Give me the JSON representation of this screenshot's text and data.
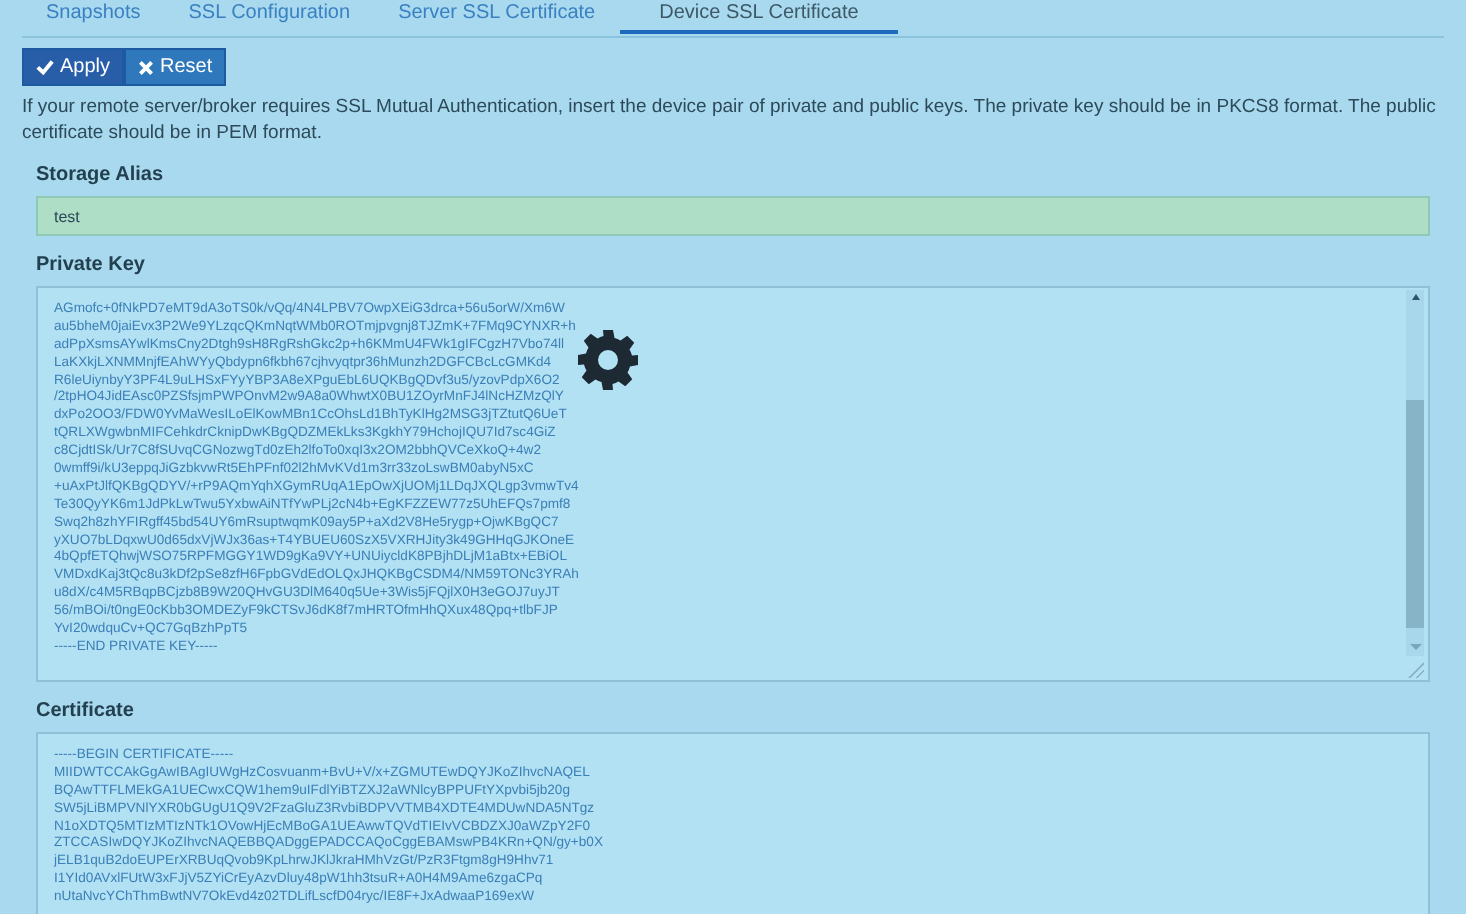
{
  "tabs": [
    {
      "label": "Snapshots",
      "selected": false
    },
    {
      "label": "SSL Configuration",
      "selected": false
    },
    {
      "label": "Server SSL Certificate",
      "selected": false
    },
    {
      "label": "Device SSL Certificate",
      "selected": true
    }
  ],
  "buttons": [
    {
      "kind": "apply",
      "label": "Apply"
    },
    {
      "kind": "reset",
      "label": "Reset"
    }
  ],
  "description": "If your remote server/broker requires SSL Mutual Authentication, insert the device pair of private and public keys. The private key should be in PKCS8 format. The public certificate should be in PEM format.",
  "fields": [
    {
      "kind": "input",
      "label": "Storage Alias",
      "value": "test",
      "valid": true
    },
    {
      "kind": "textarea",
      "label": "Private Key",
      "busy": true,
      "lines": [
        "AGmofc+0fNkPD7eMT9dA3oTS0k/vQq/4N4LPBV7OwpXEiG3drca+56u5orW/Xm6W",
        "au5bheM0jaiEvx3P2We9YLzqcQKmNqtWMb0ROTmjpvgnj8TJZmK+7FMq9CYNXR+h",
        "adPpXsmsAYwlKmsCny2Dtgh9sH8RgRshGkc2p+h6KMmU4FWk1gIFCgzH7Vbo74ll",
        "LaKXkjLXNMMnjfEAhWYyQbdypn6fkbh67cjhvyqtpr36hMunzh2DGFCBcLcGMKd4",
        "R6leUiynbyY3PF4L9uLHSxFYyYBP3A8eXPguEbL6UQKBgQDvf3u5/yzovPdpX6O2",
        "/2tpHO4JidEAsc0PZSfsjmPWPOnvM2w9A8a0WhwtX0BU1ZOyrMnFJ4lNcHZMzQlY",
        "dxPo2OO3/FDW0YvMaWesILoElKowMBn1CcOhsLd1BhTyKlHg2MSG3jTZtutQ6UeT",
        "tQRLXWgwbnMIFCehkdrCknipDwKBgQDZMEkLks3KgkhY79HchojIQU7Id7sc4GiZ",
        "c8CjdtISk/Ur7C8fSUvqCGNozwgTd0zEh2lfoTo0xqI3x2OM2bbhQVCeXkoQ+4w2",
        "0wmff9i/kU3eppqJiGzbkvwRt5EhPFnf02l2hMvKVd1m3rr33zoLswBM0abyN5xC",
        "+uAxPtJlfQKBgQDYV/+rP9AQmYqhXGymRUqA1EpOwXjUOMj1LDqJXQLgp3vmwTv4",
        "Te30QyYK6m1JdPkLwTwu5YxbwAiNTfYwPLj2cN4b+EgKFZZEW77z5UhEFQs7pmf8",
        "Swq2h8zhYFIRgff45bd54UY6mRsuptwqmK09ay5P+aXd2V8He5rygp+OjwKBgQC7",
        "yXUO7bLDqxwU0d65dxVjWJx36as+T4YBUEU60SzX5VXRHJity3k49GHHqGJKOneE",
        "4bQpfETQhwjWSO75RPFMGGY1WD9gKa9VY+UNUiycldK8PBjhDLjM1aBtx+EBiOL",
        "VMDxdKaj3tQc8u3kDf2pSe8zfH6FpbGVdEdOLQxJHQKBgCSDM4/NM59TONc3YRAh",
        "u8dX/c4M5RBqpBCjzb8B9W20QHvGU3DlM640q5Ue+3Wis5jFQjlX0H3eGOJ7uyJT",
        "56/mBOi/t0ngE0cKbb3OMDEZyF9kCTSvJ6dK8f7mHRTOfmHhQXux48Qpq+tlbFJP",
        "YvI20wdquCv+QC7GqBzhPpT5",
        "-----END PRIVATE KEY-----"
      ]
    },
    {
      "kind": "textarea",
      "label": "Certificate",
      "lines": [
        "-----BEGIN CERTIFICATE-----",
        "MIIDWTCCAkGgAwIBAgIUWgHzCosvuanm+BvU+V/x+ZGMUTEwDQYJKoZIhvcNAQEL",
        "BQAwTTFLMEkGA1UECwxCQW1hem9uIFdlYiBTZXJ2aWNlcyBPPUFtYXpvbi5jb20g",
        "SW5jLiBMPVNlYXR0bGUgU1Q9V2FzaGluZ3RvbiBDPVVTMB4XDTE4MDUwNDA5NTgz",
        "N1oXDTQ5MTIzMTIzNTk1OVowHjEcMBoGA1UEAwwTQVdTIEIvVCBDZXJ0aWZpY2F0",
        "ZTCCASIwDQYJKoZIhvcNAQEBBQADggEPADCCAQoCggEBAMswPB4KRn+QN/gy+b0X",
        "jELB1quB2doEUPErXRBUqQvob9KpLhrwJKlJkraHMhVzGt/PzR3Ftgm8gH9Hhv71",
        "I1YId0AVxlFUtW3xFJjV5ZYiCrEyAzvDluy48pW1hh3tsuR+A0H4M9Ame6zgaCPq",
        "nUtaNvcYChThmBwtNV7OkEvd4z02TDLifLscfD04ryc/IE8F+JxAdwaaP169exW"
      ]
    }
  ]
}
